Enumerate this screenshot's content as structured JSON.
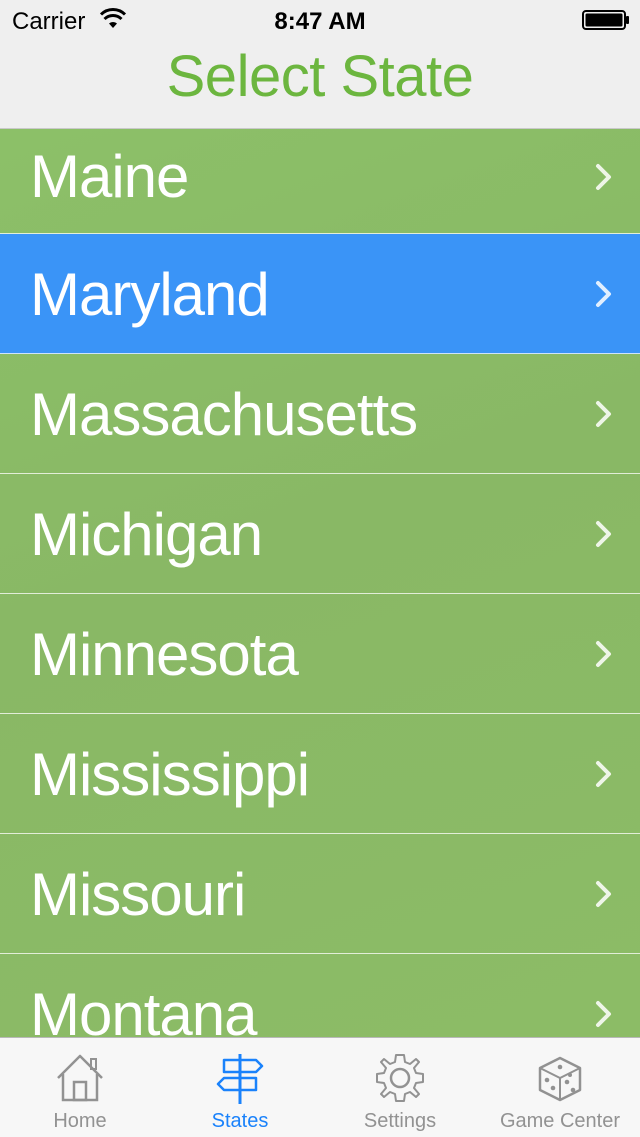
{
  "status_bar": {
    "carrier": "Carrier",
    "time": "8:47 AM"
  },
  "nav": {
    "title": "Select State"
  },
  "states": [
    {
      "label": "Maine",
      "selected": false
    },
    {
      "label": "Maryland",
      "selected": true
    },
    {
      "label": "Massachusetts",
      "selected": false
    },
    {
      "label": "Michigan",
      "selected": false
    },
    {
      "label": "Minnesota",
      "selected": false
    },
    {
      "label": "Mississippi",
      "selected": false
    },
    {
      "label": "Missouri",
      "selected": false
    },
    {
      "label": "Montana",
      "selected": false
    }
  ],
  "tabs": [
    {
      "label": "Home",
      "icon": "house-icon",
      "active": false
    },
    {
      "label": "States",
      "icon": "signpost-icon",
      "active": true
    },
    {
      "label": "Settings",
      "icon": "gear-icon",
      "active": false
    },
    {
      "label": "Game Center",
      "icon": "dice-icon",
      "active": false
    }
  ],
  "colors": {
    "title": "#6cb63f",
    "row_background": "#8cbb67",
    "selected_row": "#3a94f7",
    "tab_active": "#1a82fb",
    "tab_inactive": "#929292"
  }
}
